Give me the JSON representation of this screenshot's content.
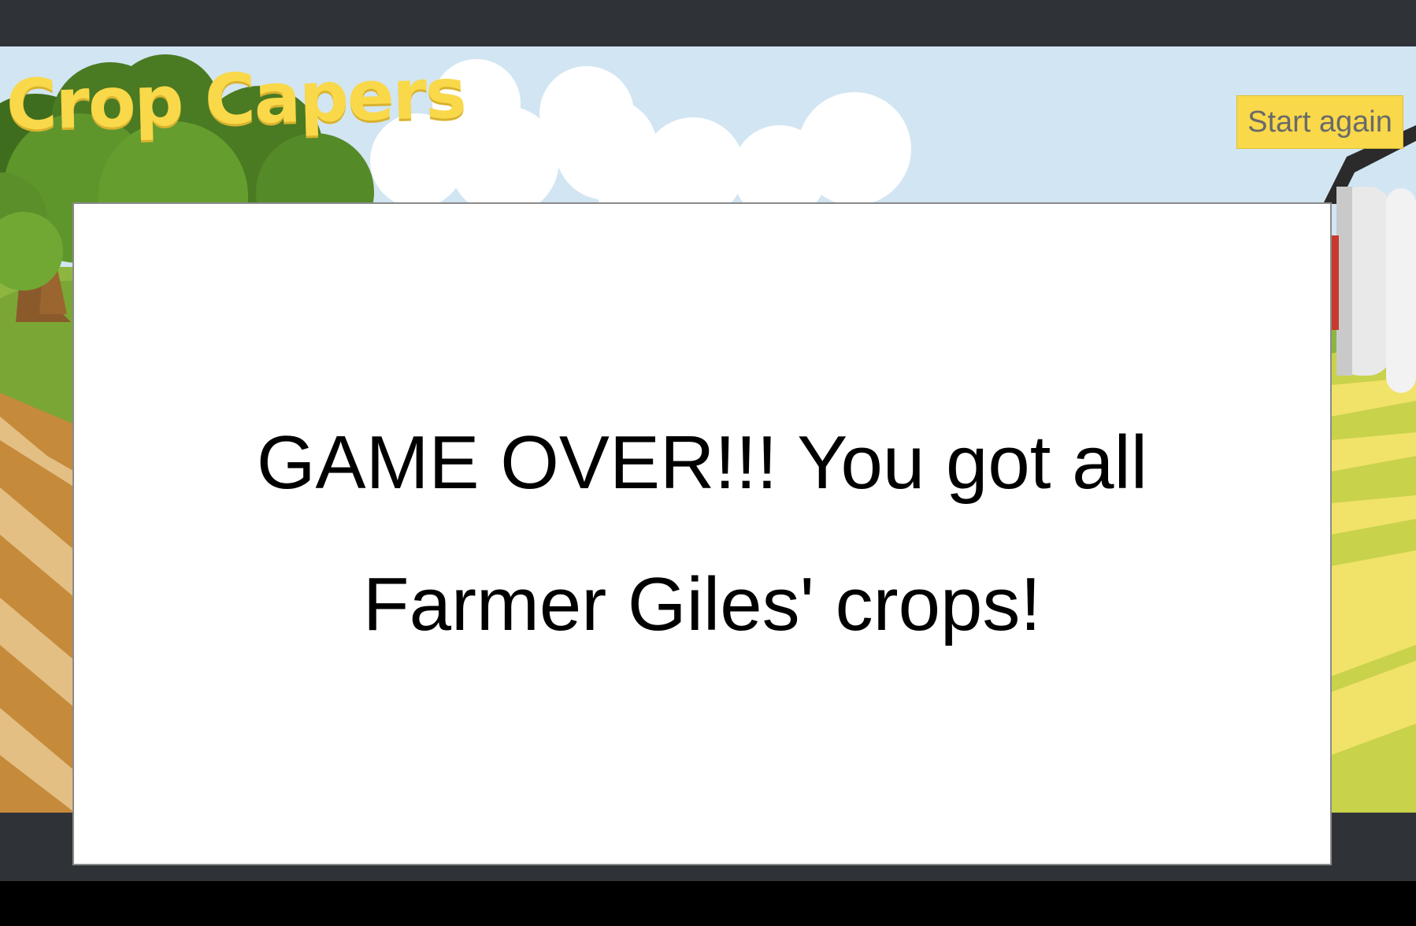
{
  "game": {
    "title": "Crop Capers",
    "start_again_label": "Start again"
  },
  "modal": {
    "message": "GAME OVER!!! You got all Farmer Giles' crops!"
  },
  "colors": {
    "title": "#f9d84a",
    "button_bg": "#f9d84a",
    "sky": "#d2e5f2",
    "frame": "#2f3337"
  }
}
